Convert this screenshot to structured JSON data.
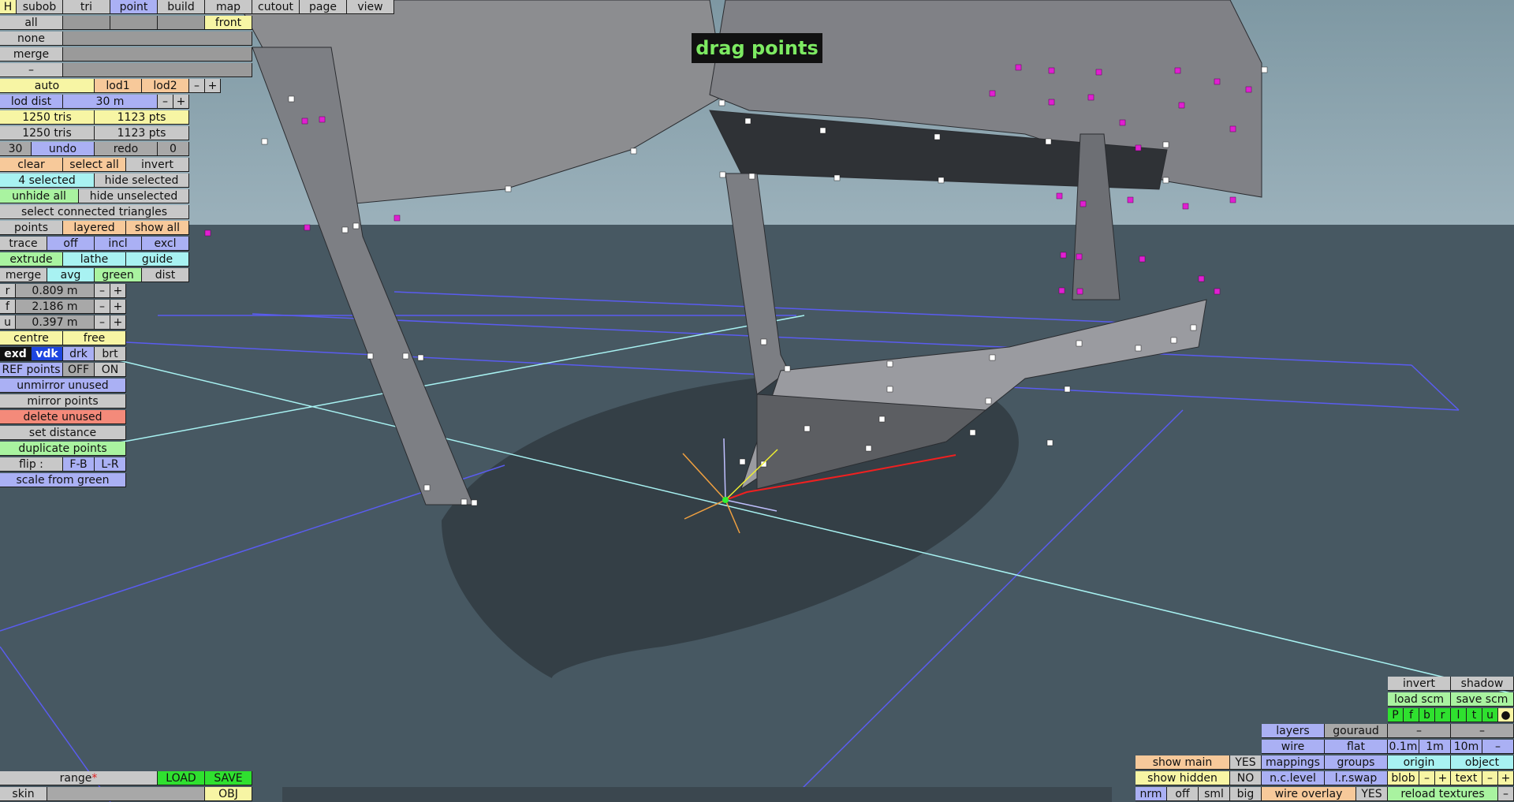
{
  "banner": "drag points",
  "menu": [
    "H",
    "subob",
    "tri",
    "point",
    "build",
    "map",
    "cutout",
    "page",
    "view"
  ],
  "select": {
    "all": "all",
    "none": "none",
    "merge": "merge",
    "dash": "–",
    "front": "front"
  },
  "lod": {
    "auto": "auto",
    "lod1": "lod1",
    "lod2": "lod2",
    "minus": "–",
    "plus": "+",
    "dist_label": "lod dist",
    "dist_value": "30 m"
  },
  "stats": {
    "tris1": "1250 tris",
    "pts1": "1123 pts",
    "tris2": "1250 tris",
    "pts2": "1123 pts"
  },
  "history": {
    "count": "30",
    "undo": "undo",
    "redo": "redo",
    "redo_count": "0"
  },
  "selection": {
    "clear": "clear",
    "select_all": "select all",
    "invert": "invert",
    "selected": "4 selected",
    "hide_selected": "hide selected",
    "unhide_all": "unhide all",
    "hide_unselected": "hide unselected",
    "connected": "select connected triangles"
  },
  "display": {
    "points": "points",
    "layered": "layered",
    "show_all": "show all"
  },
  "trace": {
    "label": "trace",
    "off": "off",
    "incl": "incl",
    "excl": "excl"
  },
  "ops": {
    "extrude": "extrude",
    "lathe": "lathe",
    "guide": "guide"
  },
  "merge_row": {
    "merge": "merge",
    "avg": "avg",
    "green": "green",
    "dist": "dist"
  },
  "coords": [
    {
      "axis": "r",
      "value": "0.809 m"
    },
    {
      "axis": "f",
      "value": "2.186 m"
    },
    {
      "axis": "u",
      "value": "0.397 m"
    }
  ],
  "pivot": {
    "centre": "centre",
    "free": "free"
  },
  "shade": {
    "exd": "exd",
    "vdk": "vdk",
    "drk": "drk",
    "brt": "brt"
  },
  "ref": {
    "label": "REF points",
    "off": "OFF",
    "on": "ON"
  },
  "actions": {
    "unmirror": "unmirror unused",
    "mirror": "mirror points",
    "delete": "delete unused",
    "set_distance": "set distance",
    "duplicate": "duplicate points",
    "flip": "flip :",
    "fb": "F-B",
    "lr": "L-R",
    "scale": "scale from green"
  },
  "file": {
    "range": "range",
    "star": "*",
    "load": "LOAD",
    "save": "SAVE",
    "skin": "skin",
    "obj": "OBJ"
  },
  "right": {
    "invert": "invert",
    "shadow": "shadow",
    "load_scm": "load scm",
    "save_scm": "save scm",
    "views": [
      "P",
      "f",
      "b",
      "r",
      "l",
      "t",
      "u",
      "●"
    ],
    "layers": "layers",
    "gouraud": "gouraud",
    "wire": "wire",
    "flat": "flat",
    "step1": "0.1m",
    "step2": "1m",
    "step3": "10m",
    "dash": "–",
    "mappings": "mappings",
    "groups": "groups",
    "origin": "origin",
    "object": "object",
    "nclevel": "n.c.level",
    "lrswap": "l.r.swap",
    "blob": "blob",
    "text": "text",
    "show_main": "show main",
    "show_main_v": "YES",
    "show_hidden": "show hidden",
    "show_hidden_v": "NO",
    "nrm": "nrm",
    "off": "off",
    "sml": "sml",
    "big": "big",
    "wire_overlay": "wire overlay",
    "wire_overlay_v": "YES",
    "reload": "reload textures",
    "minus": "–",
    "plus": "+"
  },
  "colors": {
    "sky": "#8fa7b1",
    "ground": "#475862",
    "mesh": "#8c8d90",
    "point": "#ffffff",
    "unused_point": "#e020d0",
    "grid": "#5a5cf0",
    "axis": "#a8f2f2"
  }
}
